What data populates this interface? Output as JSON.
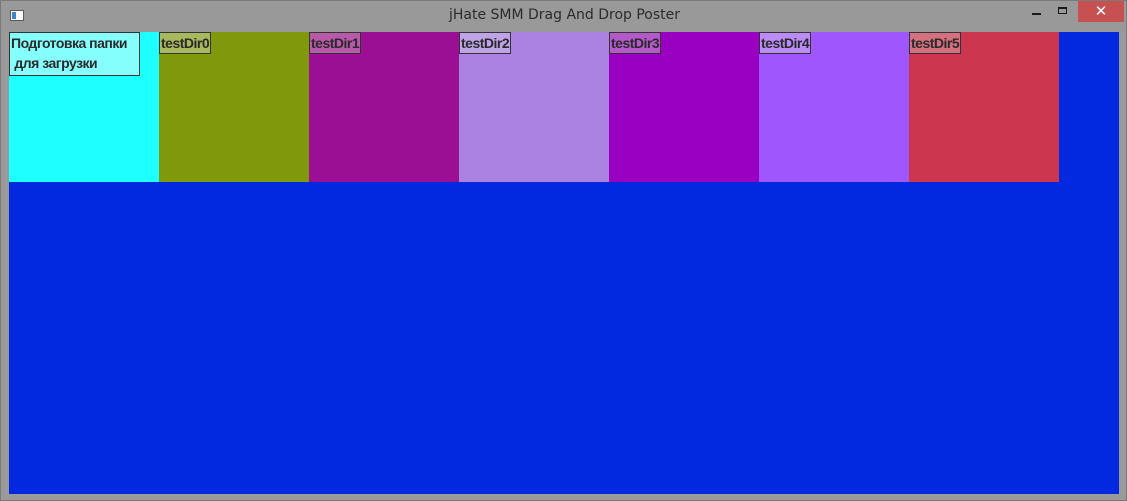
{
  "window": {
    "title": "jHate SMM Drag And Drop Poster",
    "close_glyph": "✕"
  },
  "tiles": [
    {
      "label": "Подготовка папки\n для загрузки",
      "color": "#1effff",
      "label_bg": "#86ffff"
    },
    {
      "label": "testDir0",
      "color": "#80980b",
      "label_bg": "#a8b85c"
    },
    {
      "label": "testDir1",
      "color": "#9a0f94",
      "label_bg": "#b85aa9"
    },
    {
      "label": "testDir2",
      "color": "#ab82e2",
      "label_bg": "#c0a4e8"
    },
    {
      "label": "testDir3",
      "color": "#9900c2",
      "label_bg": "#b359ca"
    },
    {
      "label": "testDir4",
      "color": "#a056fd",
      "label_bg": "#bb8bf8"
    },
    {
      "label": "testDir5",
      "color": "#cc364f",
      "label_bg": "#d4707f"
    }
  ],
  "colors": {
    "workspace_background": "#0228e0",
    "title_bar": "#999999",
    "close_button": "#c75050"
  }
}
